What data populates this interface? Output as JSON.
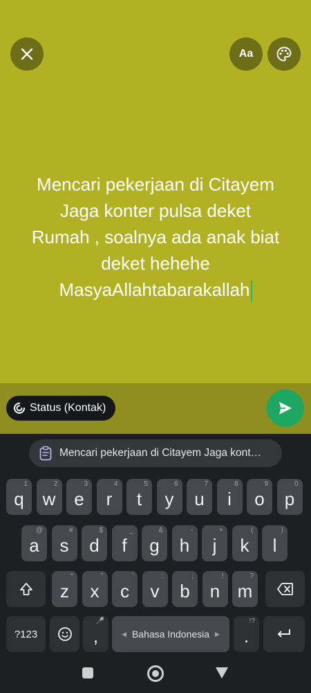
{
  "colors": {
    "status_background": "#b1b123",
    "send_button": "#1ea763",
    "caret": "#1ec06e"
  },
  "toolbar": {
    "close_icon": "close-icon",
    "font_button_label": "Aa",
    "palette_icon": "palette-icon"
  },
  "status": {
    "lines": [
      "Mencari pekerjaan di Citayem",
      "Jaga konter pulsa deket",
      "Rumah , soalnya ada anak biat",
      "deket hehehe",
      "MasyaAllahtabarakallah"
    ]
  },
  "audience": {
    "label": "Status (Kontak)"
  },
  "send": {
    "icon": "send-icon"
  },
  "clipboard": {
    "suggestion": "Mencari pekerjaan di Citayem Jaga kont…"
  },
  "keyboard": {
    "row1": [
      {
        "k": "q",
        "h": "1"
      },
      {
        "k": "w",
        "h": "2"
      },
      {
        "k": "e",
        "h": "3"
      },
      {
        "k": "r",
        "h": "4"
      },
      {
        "k": "t",
        "h": "5"
      },
      {
        "k": "y",
        "h": "6"
      },
      {
        "k": "u",
        "h": "7"
      },
      {
        "k": "i",
        "h": "8"
      },
      {
        "k": "o",
        "h": "9"
      },
      {
        "k": "p",
        "h": "0"
      }
    ],
    "row2": [
      {
        "k": "a",
        "h": "@"
      },
      {
        "k": "s",
        "h": "#"
      },
      {
        "k": "d",
        "h": "$"
      },
      {
        "k": "f",
        "h": "_"
      },
      {
        "k": "g",
        "h": "&"
      },
      {
        "k": "h",
        "h": "-"
      },
      {
        "k": "j",
        "h": "+"
      },
      {
        "k": "k",
        "h": "("
      },
      {
        "k": "l",
        "h": ")"
      }
    ],
    "row3": [
      {
        "k": "z",
        "h": "*"
      },
      {
        "k": "x",
        "h": "\""
      },
      {
        "k": "c",
        "h": "'"
      },
      {
        "k": "v",
        "h": ":"
      },
      {
        "k": "b",
        "h": ";"
      },
      {
        "k": "n",
        "h": "!"
      },
      {
        "k": "m",
        "h": "?"
      }
    ],
    "symbols_label": "?123",
    "comma_label": ",",
    "comma_hint": "🎤",
    "space_label": "Bahasa Indonesia",
    "space_hint": "🌐",
    "period_label": ".",
    "period_hint": "!?",
    "shift_icon": "shift-icon",
    "backspace_icon": "backspace-icon",
    "emoji_icon": "emoji-icon",
    "enter_icon": "enter-icon"
  },
  "nav": {
    "recents_icon": "recents-icon",
    "home_icon": "home-icon",
    "back_icon": "back-icon"
  }
}
